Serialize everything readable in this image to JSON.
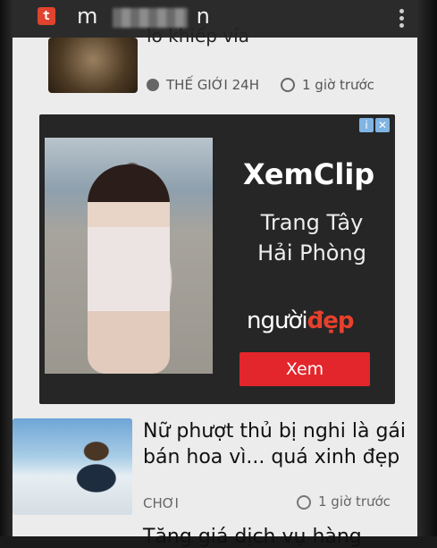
{
  "app_bar": {
    "logo_letter": "t",
    "title_start": "m",
    "title_end": "n",
    "menu_icon": "overflow-menu-icon"
  },
  "top_article": {
    "headline_partial": "lo khiếp vía",
    "category": "THẾ GIỚI 24H",
    "time": "1 giờ trước"
  },
  "ad": {
    "badge_info": "i",
    "badge_close": "✕",
    "title": "XemClip",
    "subtitle": "Trang Tây Hải Phòng",
    "brand_left": "người",
    "brand_right": "đẹp",
    "button": "Xem"
  },
  "article2": {
    "title": "Nữ phượt thủ bị nghi là gái bán hoa vì... quá xinh đẹp",
    "category": "CHƠI",
    "time": "1 giờ trước"
  },
  "article3": {
    "title_partial": "Tăng giá dịch vụ hàng"
  },
  "colors": {
    "accent": "#e3262b",
    "logo": "#e0432f",
    "info_badge": "#7fb4e3"
  }
}
